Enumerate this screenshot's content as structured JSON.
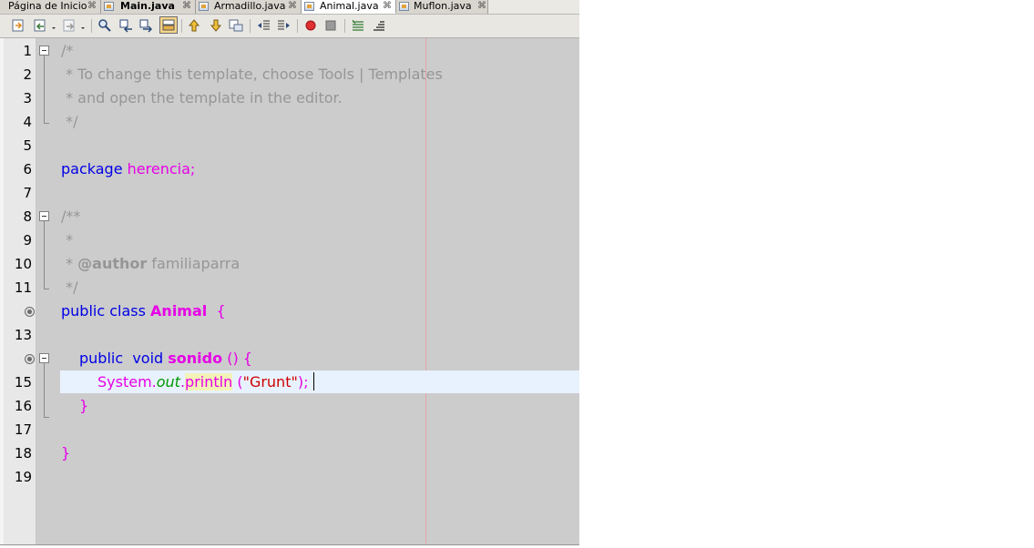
{
  "tabs": [
    {
      "label": "Página de Inicio",
      "close": "⌘",
      "active": false,
      "bold": false
    },
    {
      "label": "Main.java",
      "close": "⌘",
      "active": false,
      "bold": true
    },
    {
      "label": "Armadillo.java",
      "close": "⌘",
      "active": false,
      "bold": false
    },
    {
      "label": "Animal.java",
      "close": "⌘",
      "active": true,
      "bold": false
    },
    {
      "label": "Muflon.java",
      "close": "⌘",
      "active": false,
      "bold": false
    }
  ],
  "toolbar_icons": [
    "last-edit-icon",
    "back-icon",
    "forward-icon",
    "find-icon",
    "find-previous-icon",
    "find-next-icon",
    "toggle-highlight-icon",
    "previous-bookmark-icon",
    "next-bookmark-icon",
    "toggle-bookmark-icon",
    "shift-left-icon",
    "shift-right-icon",
    "start-macro-icon",
    "stop-macro-icon",
    "comment-icon",
    "uncomment-icon"
  ],
  "editor": {
    "line_numbers": [
      "1",
      "2",
      "3",
      "4",
      "5",
      "6",
      "7",
      "8",
      "9",
      "10",
      "11",
      "12",
      "13",
      "14",
      "15",
      "16",
      "17",
      "18",
      "19"
    ],
    "current_line": 15,
    "lines": {
      "l1": "/*",
      "l2": " * To change this template, choose Tools | Templates",
      "l3": " * and open the template in the editor.",
      "l4": " */",
      "l6_kw": "package",
      "l6_name": "herencia;",
      "l8": "/**",
      "l9": " *",
      "l10_pre": " * ",
      "l10_tag": "@author",
      "l10_post": " familiaparra",
      "l11": " */",
      "l12_kw": "public class",
      "l12_cls": "Animal",
      "l12_brace": "{",
      "l14_kw": "public  void",
      "l14_name": "sonido",
      "l14_rest": "() {",
      "l15_sys": "System.",
      "l15_out": "out",
      "l15_dot": ".",
      "l15_println": "println",
      "l15_open": "(",
      "l15_str": "\"Grunt\"",
      "l15_close": ");",
      "l16": "}",
      "l18": "}"
    }
  },
  "colors": {
    "keyword": "#0000e6",
    "class_name": "#e600e6",
    "comment": "#969696",
    "string": "#ce0000",
    "field": "#009900",
    "editor_bg": "#cccccc",
    "current_line_bg": "#e8f2fe"
  }
}
